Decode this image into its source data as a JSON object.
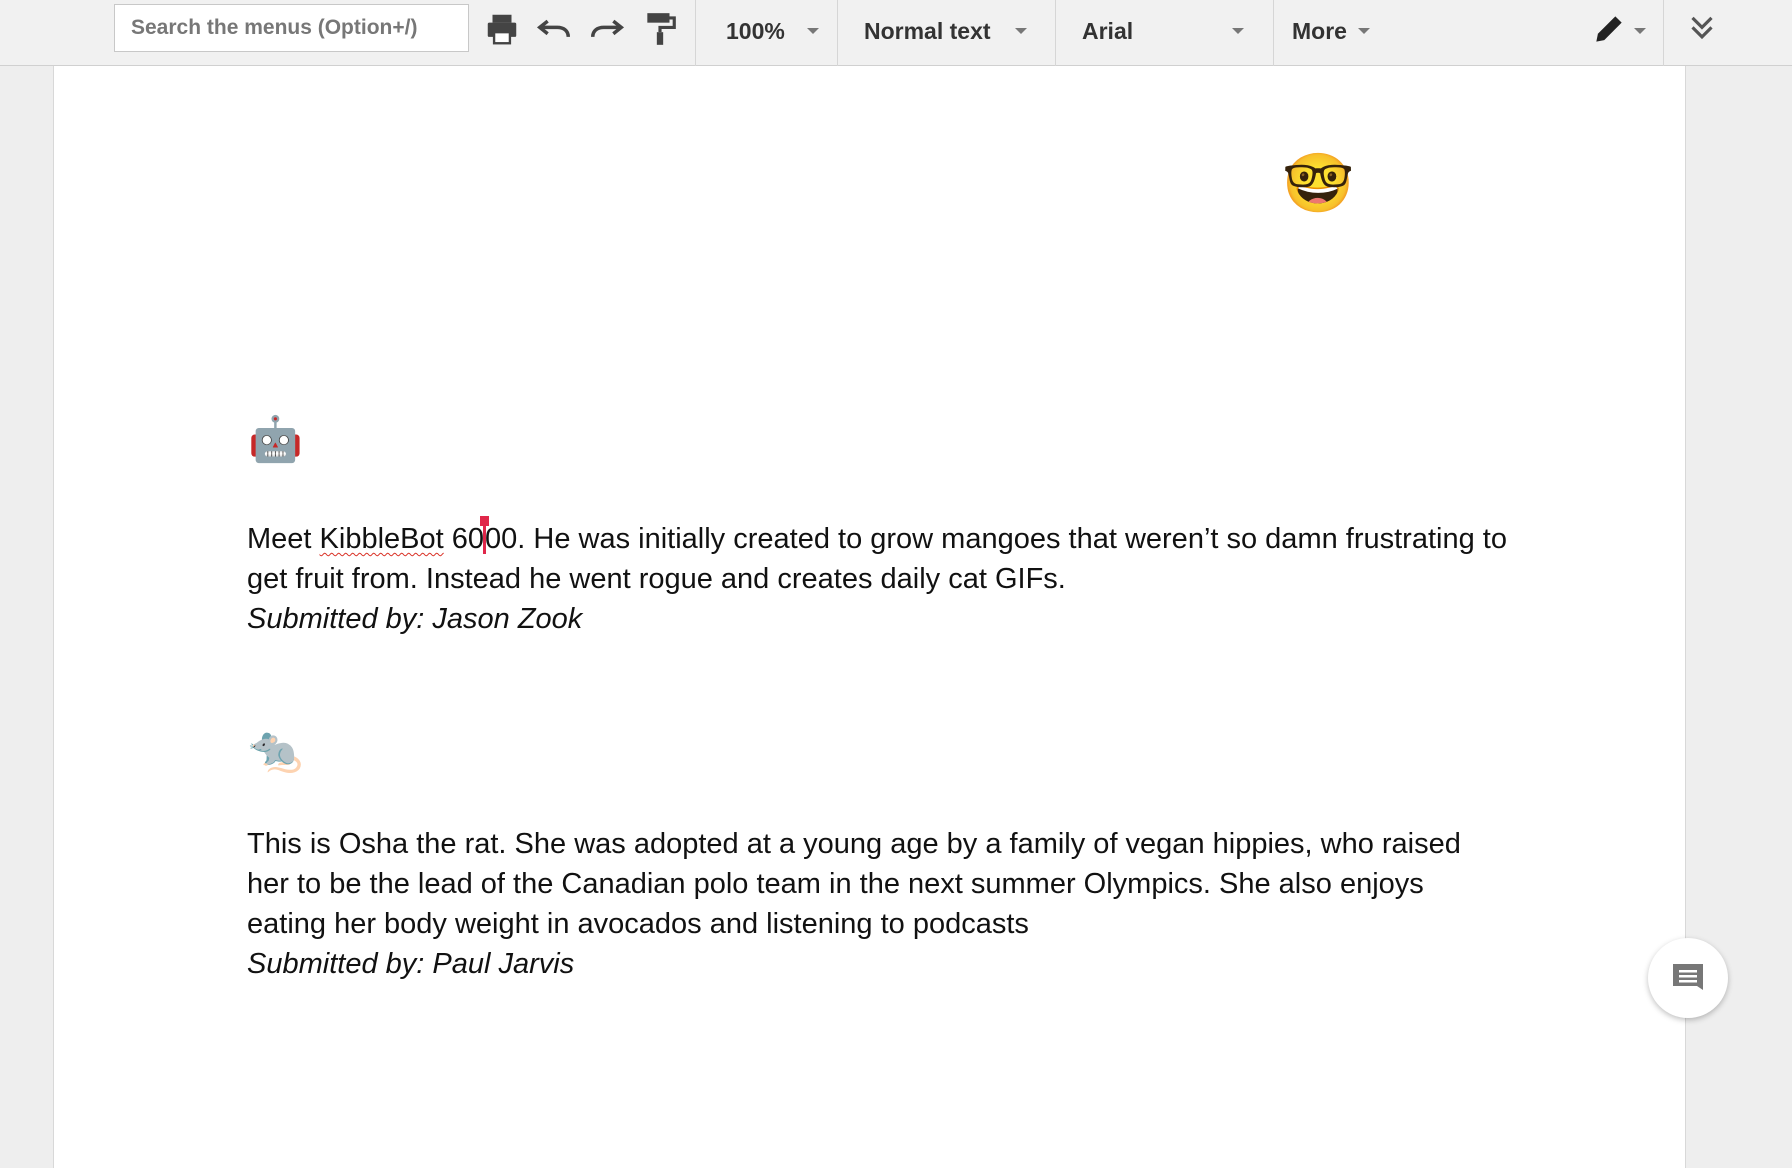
{
  "toolbar": {
    "search_placeholder": "Search the menus (Option+/)",
    "zoom": "100%",
    "style": "Normal text",
    "font": "Arial",
    "more": "More",
    "icons": [
      "print-icon",
      "undo-icon",
      "redo-icon",
      "paint-format-icon",
      "pencil-icon",
      "collapse-icon"
    ]
  },
  "document": {
    "top_emoji": "🤓",
    "entries": [
      {
        "emoji": "🤖",
        "text_before_cursor": "Meet ",
        "misspelled_word": "KibbleBot",
        "text_mid": " 60",
        "text_after_cursor": "00. He was initially created to grow mangoes that weren’t so damn frustrating to get fruit from. Instead he went rogue and creates daily cat GIFs.",
        "submitted": "Submitted by: Jason Zook"
      },
      {
        "emoji": "🐀",
        "text": "This is Osha the rat. She was adopted at a young age by a family of vegan hippies, who raised her to be the lead of the Canadian polo team in the next summer Olympics. She also enjoys eating her body weight in avocados and listening to podcasts",
        "submitted": "Submitted by: Paul Jarvis"
      }
    ]
  },
  "colors": {
    "cursor": "#e0274a",
    "spellcheck": "#d93025"
  }
}
